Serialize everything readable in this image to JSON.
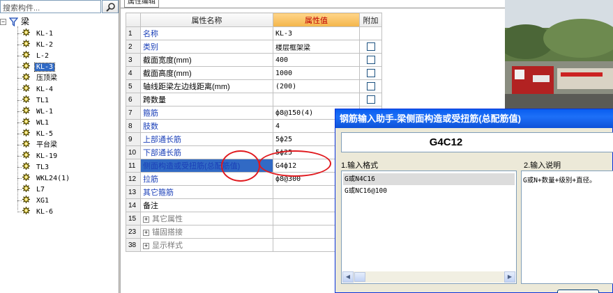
{
  "search": {
    "value": "搜索构件..."
  },
  "tree": {
    "root_label": "梁",
    "items": [
      {
        "label": "KL-1"
      },
      {
        "label": "KL-2"
      },
      {
        "label": "L-2"
      },
      {
        "label": "KL-3",
        "selected": true
      },
      {
        "label": "压顶梁"
      },
      {
        "label": "KL-4"
      },
      {
        "label": "TL1"
      },
      {
        "label": "WL-1"
      },
      {
        "label": "WL1"
      },
      {
        "label": "KL-5"
      },
      {
        "label": "平台梁"
      },
      {
        "label": "KL-19"
      },
      {
        "label": "TL3"
      },
      {
        "label": "WKL24(1)"
      },
      {
        "label": "L7"
      },
      {
        "label": "XG1"
      },
      {
        "label": "KL-6"
      }
    ]
  },
  "prop_panel": {
    "tab_label": "属性编辑",
    "headers": {
      "name": "属性名称",
      "value": "属性值",
      "extra": "附加"
    },
    "rows": [
      {
        "num": "1",
        "name": "名称",
        "value": "KL-3",
        "check": false,
        "style": "blue"
      },
      {
        "num": "2",
        "name": "类别",
        "value": "楼层框架梁",
        "check": true,
        "style": "blue"
      },
      {
        "num": "3",
        "name": "截面宽度(mm)",
        "value": "400",
        "check": true,
        "style": "black"
      },
      {
        "num": "4",
        "name": "截面高度(mm)",
        "value": "1000",
        "check": true,
        "style": "black"
      },
      {
        "num": "5",
        "name": "轴线距梁左边线距离(mm)",
        "value": "(200)",
        "check": true,
        "style": "black"
      },
      {
        "num": "6",
        "name": "跨数量",
        "value": "",
        "check": true,
        "style": "black"
      },
      {
        "num": "7",
        "name": "箍筋",
        "value": "ф8@150(4)",
        "check": false,
        "style": "blue"
      },
      {
        "num": "8",
        "name": "肢数",
        "value": "4",
        "check": false,
        "style": "blue"
      },
      {
        "num": "9",
        "name": "上部通长筋",
        "value": "5ф25",
        "check": false,
        "style": "blue"
      },
      {
        "num": "10",
        "name": "下部通长筋",
        "value": "5ф25",
        "check": false,
        "style": "blue"
      },
      {
        "num": "11",
        "name": "侧面构造或受扭筋(总配筋值)",
        "value": "G4ф12",
        "check": false,
        "style": "blue",
        "selected": true
      },
      {
        "num": "12",
        "name": "拉筋",
        "value": "ф8@300",
        "check": false,
        "style": "blue"
      },
      {
        "num": "13",
        "name": "其它箍筋",
        "value": "",
        "check": false,
        "style": "blue"
      },
      {
        "num": "14",
        "name": "备注",
        "value": "",
        "check": false,
        "style": "black"
      },
      {
        "num": "15",
        "name": "其它属性",
        "value": "",
        "check": false,
        "style": "gray",
        "expander": "+"
      },
      {
        "num": "23",
        "name": "锚固搭接",
        "value": "",
        "check": false,
        "style": "gray",
        "expander": "+"
      },
      {
        "num": "38",
        "name": "显示样式",
        "value": "",
        "check": false,
        "style": "gray",
        "expander": "+"
      }
    ]
  },
  "dialog": {
    "title": "钢筋输入助手-梁侧面构造或受扭筋(总配筋值)",
    "code": "G4C12",
    "format_label": "1.输入格式",
    "desc_label": "2.输入说明",
    "formats": [
      "G或N4C16",
      "G或NC16@100"
    ],
    "description": "G或N+数量+级别+直径。"
  },
  "colors": {
    "annotation": "#e0191e",
    "selection": "#316ac5",
    "title_bar": "#0a5ef0",
    "header_value": "#f3b54a"
  }
}
